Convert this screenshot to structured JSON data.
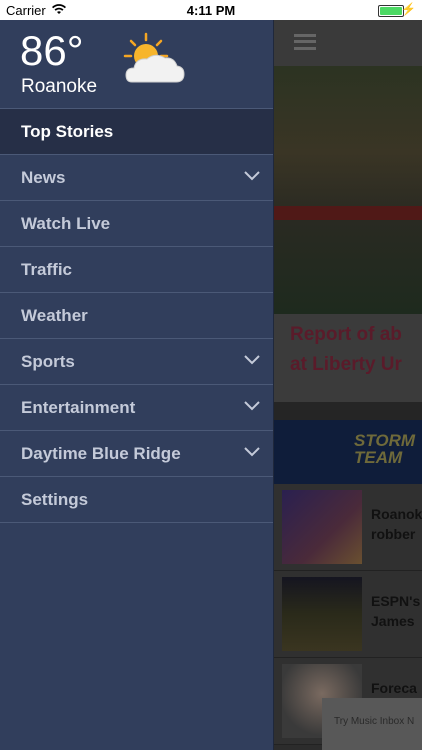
{
  "status_bar": {
    "carrier": "Carrier",
    "time": "4:11 PM"
  },
  "weather": {
    "temperature": "86°",
    "city": "Roanoke",
    "icon": "partly-cloudy-icon"
  },
  "menu": {
    "items": [
      {
        "label": "Top Stories",
        "active": true,
        "expandable": false
      },
      {
        "label": "News",
        "active": false,
        "expandable": true
      },
      {
        "label": "Watch Live",
        "active": false,
        "expandable": false
      },
      {
        "label": "Traffic",
        "active": false,
        "expandable": false
      },
      {
        "label": "Weather",
        "active": false,
        "expandable": false
      },
      {
        "label": "Sports",
        "active": false,
        "expandable": true
      },
      {
        "label": "Entertainment",
        "active": false,
        "expandable": true
      },
      {
        "label": "Daytime Blue Ridge",
        "active": false,
        "expandable": true
      },
      {
        "label": "Settings",
        "active": false,
        "expandable": false
      }
    ]
  },
  "background": {
    "headline": [
      "Report of ab",
      "at Liberty Ur"
    ],
    "banner": [
      "STORM",
      "TEAM"
    ],
    "stories": [
      [
        "Roanok",
        "robber"
      ],
      [
        "ESPN's",
        "James"
      ],
      [
        "Foreca",
        ""
      ]
    ],
    "ad_text": "Try Music Inbox N"
  },
  "colors": {
    "drawer": "#313e5c",
    "active_item": "#262f47",
    "divider": "#4b5977",
    "menu_text": "#c4cad9"
  }
}
